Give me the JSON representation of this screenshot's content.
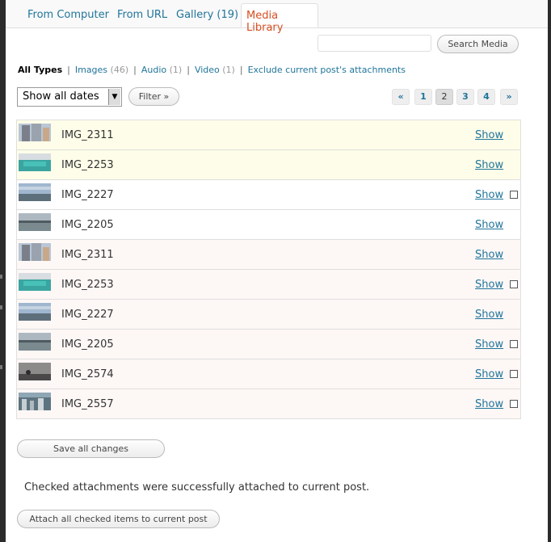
{
  "tabs": {
    "from_computer": "From Computer",
    "from_url": "From URL",
    "gallery": "Gallery (19)",
    "media_library": "Media Library"
  },
  "search": {
    "value": "",
    "button_label": "Search Media"
  },
  "type_filters": {
    "all_types": "All Types",
    "images_label": "Images",
    "images_count": "(46)",
    "audio_label": "Audio",
    "audio_count": "(1)",
    "video_label": "Video",
    "video_count": "(1)",
    "exclude_label": "Exclude current post's attachments",
    "separator": "|"
  },
  "date_filter": {
    "selected": "Show all dates",
    "filter_button": "Filter »"
  },
  "pagination": {
    "prev": "«",
    "pages": [
      "1",
      "2",
      "3",
      "4"
    ],
    "current_page": "2",
    "next": "»"
  },
  "media_items": [
    {
      "name": "IMG_2311",
      "show": "Show",
      "checkbox": false,
      "thumb": "building"
    },
    {
      "name": "IMG_2253",
      "show": "Show",
      "checkbox": false,
      "thumb": "pool"
    },
    {
      "name": "IMG_2227",
      "show": "Show",
      "checkbox": true,
      "thumb": "sky"
    },
    {
      "name": "IMG_2205",
      "show": "Show",
      "checkbox": false,
      "thumb": "river"
    },
    {
      "name": "IMG_2311",
      "show": "Show",
      "checkbox": false,
      "thumb": "building"
    },
    {
      "name": "IMG_2253",
      "show": "Show",
      "checkbox": true,
      "thumb": "pool"
    },
    {
      "name": "IMG_2227",
      "show": "Show",
      "checkbox": false,
      "thumb": "sky"
    },
    {
      "name": "IMG_2205",
      "show": "Show",
      "checkbox": true,
      "thumb": "river"
    },
    {
      "name": "IMG_2574",
      "show": "Show",
      "checkbox": true,
      "thumb": "dusk"
    },
    {
      "name": "IMG_2557",
      "show": "Show",
      "checkbox": true,
      "thumb": "city"
    }
  ],
  "actions": {
    "save_all": "Save all changes",
    "success_message": "Checked attachments were successfully attached to current post.",
    "attach_all": "Attach all checked items to current post"
  },
  "colors": {
    "link": "#21759b",
    "active_tab": "#d54e21",
    "row_highlight": "#fdfde9",
    "row_pink": "#fdf7f6"
  }
}
